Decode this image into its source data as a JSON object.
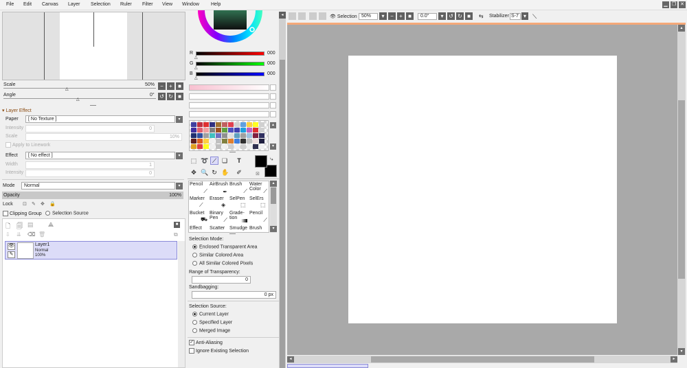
{
  "menu": [
    "File",
    "Edit",
    "Canvas",
    "Layer",
    "Selection",
    "Ruler",
    "Filter",
    "View",
    "Window",
    "Help"
  ],
  "window_controls": [
    "minimize",
    "restore",
    "close"
  ],
  "navigator": {
    "scale_label": "Scale",
    "scale_value": "50%",
    "angle_label": "Angle",
    "angle_value": "0°"
  },
  "layer_effect": {
    "header": "Layer Effect",
    "paper_label": "Paper",
    "paper_value": "[ No Texture ]",
    "intensity_label": "Intensity",
    "intensity_value": "0",
    "scale_label": "Scale",
    "scale_value": "10%",
    "apply_linework": "Apply to Linework",
    "effect_label": "Effect",
    "effect_value": "[ No effect ]",
    "width_label": "Width",
    "width_value": "1",
    "intensity2_label": "Intensity",
    "intensity2_value": "0"
  },
  "layer_props": {
    "mode_label": "Mode",
    "mode_value": "Normal",
    "opacity_label": "Opacity",
    "opacity_value": "100%",
    "lock_label": "Lock",
    "clipping_group": "Clipping Group",
    "selection_source": "Selection Source"
  },
  "layers": [
    {
      "name": "Layer1",
      "mode": "Normal",
      "opacity": "100%"
    }
  ],
  "color": {
    "r_label": "R",
    "r_value": "000",
    "g_label": "G",
    "g_value": "000",
    "b_label": "B",
    "b_value": "000",
    "fg": "#000000",
    "bg": "#000000"
  },
  "swatches": [
    "#4040a0",
    "#c03040",
    "#e03030",
    "#303080",
    "#a07030",
    "#c06060",
    "#e04050",
    "#d0d0d0",
    "#60a0e0",
    "#ffd040",
    "#ffff20",
    "#d0d0d0",
    "#4030a0",
    "#e06070",
    "#f0a0a0",
    "#808080",
    "#a05020",
    "#60a040",
    "#5050c0",
    "#4040b0",
    "#20a0e0",
    "#c060c0",
    "#e03030",
    "#d0d0d0",
    "#203070",
    "#3050a0",
    "#a0a0a0",
    "#40c0c0",
    "#7070c0",
    "#909090",
    "#e0e0e0",
    "#60a0c0",
    "#a0a0a0",
    "#a0c0e0",
    "#802040",
    "#303060",
    "#602020",
    "#e06020",
    "#ffd040",
    "#f0f0f0",
    "#c0c0c0",
    "#808040",
    "#e08030",
    "#4080e0",
    "#303030",
    "#c0c0c0",
    "#f0e0e0",
    "#202040",
    "#e0a020",
    "#e04040",
    "#ffff20",
    "#f0f0f0",
    "#c0c0c0",
    "#f0f0f0",
    "#d0d0d0",
    "#f0f0f0",
    "#d0d0d0",
    "#f0f0f0",
    "#303050",
    "#f0f0f0"
  ],
  "tools_row1": [
    "rect-select",
    "lasso",
    "magic-wand",
    "move-layer",
    "text"
  ],
  "tools_row2": [
    "move",
    "zoom",
    "rotate",
    "hand",
    "eyedropper"
  ],
  "brushes": [
    [
      "Pencil",
      "AirBrush",
      "Brush",
      "Water Color"
    ],
    [
      "Marker",
      "Eraser",
      "SelPen",
      "SelErs"
    ],
    [
      "Bucket",
      "Binary Pen",
      "Grade- tion",
      "Pencil"
    ],
    [
      "Effect",
      "Scatter",
      "Smudge",
      "Brush"
    ]
  ],
  "tool_options": {
    "selection_mode": "Selection Mode:",
    "modes": [
      "Enclosed Transparent Area",
      "Similar Colored Area",
      "All Similar Colored Pixels"
    ],
    "range_label": "Range of Transparency:",
    "range_value": "0",
    "sandbag_label": "Sandbagging:",
    "sandbag_value": "0 px",
    "source_label": "Selection Source:",
    "sources": [
      "Current Layer",
      "Specified Layer",
      "Merged Image"
    ],
    "anti_aliasing": "Anti-Aliasing",
    "ignore_selection": "Ignore Existing Selection"
  },
  "toolbar": {
    "selection_label": "Selection",
    "zoom_value": "50%",
    "angle_value": "0.0°",
    "stabilizer_label": "Stabilizer",
    "stabilizer_value": "S-7"
  }
}
